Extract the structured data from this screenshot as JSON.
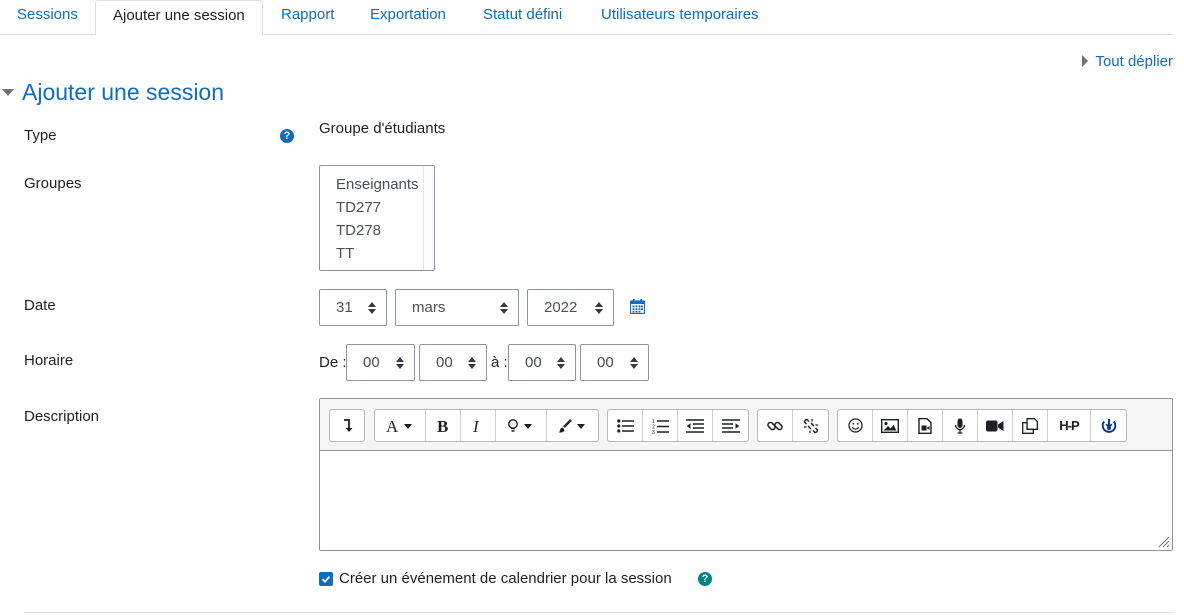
{
  "tabs": [
    {
      "label": "Sessions",
      "active": false
    },
    {
      "label": "Ajouter une session",
      "active": true
    },
    {
      "label": "Rapport",
      "active": false
    },
    {
      "label": "Exportation",
      "active": false
    },
    {
      "label": "Statut défini",
      "active": false
    },
    {
      "label": "Utilisateurs temporaires",
      "active": false
    }
  ],
  "expand_all": "Tout déplier",
  "section_title": "Ajouter une session",
  "form": {
    "type": {
      "label": "Type",
      "value": "Groupe d'étudiants"
    },
    "groups": {
      "label": "Groupes",
      "options": [
        "Enseignants",
        "TD277",
        "TD278",
        "TT"
      ]
    },
    "date": {
      "label": "Date",
      "day": "31",
      "month": "mars",
      "year": "2022"
    },
    "time": {
      "label": "Horaire",
      "from_label": "De :",
      "from_hour": "00",
      "from_minute": "00",
      "to_label": "à :",
      "to_hour": "00",
      "to_minute": "00"
    },
    "description": {
      "label": "Description"
    },
    "calendar_event": {
      "label": "Créer un événement de calendrier pour la session",
      "checked": true
    }
  },
  "toolbar": {
    "groups": [
      [
        "collapse-icon"
      ],
      [
        "font-color-icon",
        "bold-icon",
        "italic-icon",
        "lightbulb-icon",
        "brush-icon"
      ],
      [
        "unordered-list-icon",
        "ordered-list-icon",
        "outdent-icon",
        "indent-icon"
      ],
      [
        "link-icon",
        "unlink-icon"
      ],
      [
        "emoji-icon",
        "image-icon",
        "media-icon",
        "record-audio-icon",
        "record-video-icon",
        "manage-files-icon",
        "h5p-icon",
        "accessibility-checker-icon"
      ]
    ],
    "h5p_text": "H-P"
  },
  "colors": {
    "link": "#0f6cbf",
    "help": "#0f6cbf",
    "help_alt": "#00828a",
    "border": "#8f959e"
  }
}
